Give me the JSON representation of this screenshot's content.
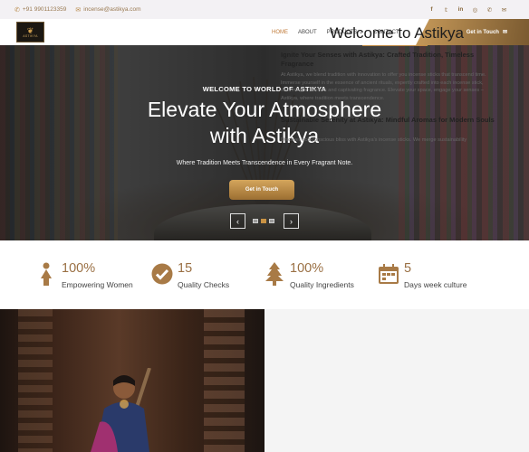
{
  "topbar": {
    "phone": "+91 9901123359",
    "email": "incense@astikya.com",
    "socials": [
      "facebook-icon",
      "twitter-icon",
      "linkedin-icon",
      "instagram-icon",
      "whatsapp-icon",
      "email-icon"
    ]
  },
  "nav": {
    "logo_text": "ASTIKYA",
    "items": [
      {
        "label": "HOME",
        "active": true
      },
      {
        "label": "ABOUT"
      },
      {
        "label": "PRODUCTS ⌄"
      },
      {
        "label": "CONTACT"
      }
    ],
    "cta_label": "Get in Touch"
  },
  "hero": {
    "eyebrow": "WELCOME TO WORLD OF ASTIKYA",
    "title_line1": "Elevate Your Atmosphere",
    "title_line2": "with Astikya",
    "subtitle": "Where Tradition Meets Transcendence in Every Fragrant Note.",
    "button_label": "Get in Touch",
    "prev_arrow": "‹",
    "next_arrow": "›"
  },
  "stats": [
    {
      "value": "100%",
      "label": "Empowering Women",
      "icon": "woman-icon"
    },
    {
      "value": "15",
      "label": "Quality Checks",
      "icon": "check-circle-icon"
    },
    {
      "value": "100%",
      "label": "Quality Ingredients",
      "icon": "tree-icon"
    },
    {
      "value": "5",
      "label": "Days week culture",
      "icon": "calendar-icon"
    }
  ],
  "about": {
    "title": "Welcome to Astikya",
    "heading1": "Ignite Your Senses with Astikya: Crafted Tradition, Timeless Fragrance",
    "para1": "At Astikya, we blend tradition with innovation to offer you incense sticks that transcend time. Immerse yourself in the essence of ancient rituals, expertly crafted into each incense stick, delivering a timeless and captivating fragrance. Elevate your space, engage your senses – Astikya, where tradition meets transcendence.",
    "heading2": "Sustainable Serenity at Astikya: Mindful Aromas for Modern Souls",
    "para2": "Discover eco-conscious bliss with Astikya's incense sticks. We merge sustainability"
  },
  "colors": {
    "accent": "#c08a44",
    "topbar_bg": "#f3f1f4",
    "about_bg": "#f4f4f4"
  }
}
